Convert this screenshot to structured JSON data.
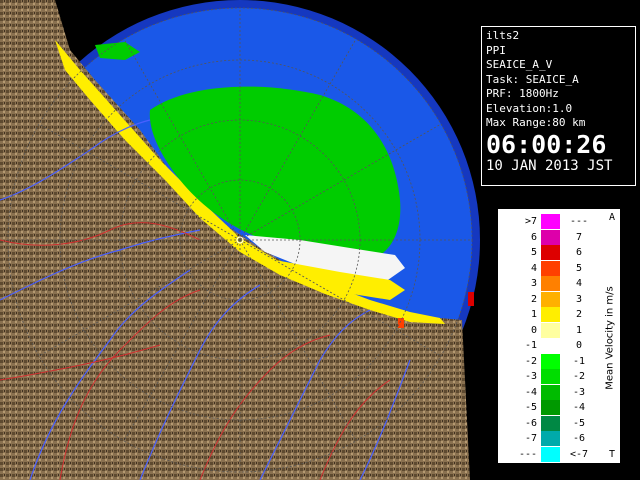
{
  "info": {
    "station": "ilts2",
    "scan_type": "PPI",
    "product": "SEAICE_A_V",
    "task": "Task: SEAICE_A",
    "prf": "PRF: 1800Hz",
    "elevation": "Elevation:1.0",
    "max_range": "Max Range:80 km",
    "time": "06:00:26",
    "date": "10 JAN 2013 JST"
  },
  "legend": {
    "title": "Mean Velocity in m/s",
    "top_mark": "A",
    "bottom_mark": "T",
    "rows": [
      {
        "left": ">7",
        "right": "---",
        "color": "#ff00ff"
      },
      {
        "left": "6",
        "right": "7",
        "color": "#dd00aa"
      },
      {
        "left": "5",
        "right": "6",
        "color": "#dd0000"
      },
      {
        "left": "4",
        "right": "5",
        "color": "#ff4000"
      },
      {
        "left": "3",
        "right": "4",
        "color": "#ff8000"
      },
      {
        "left": "2",
        "right": "3",
        "color": "#ffb000"
      },
      {
        "left": "1",
        "right": "2",
        "color": "#ffee00"
      },
      {
        "left": "0",
        "right": "1",
        "color": "#ffffa0"
      },
      {
        "left": "-1",
        "right": "0",
        "color": "#ffffff"
      },
      {
        "left": "-2",
        "right": "-1",
        "color": "#00ff00"
      },
      {
        "left": "-3",
        "right": "-2",
        "color": "#00dd00"
      },
      {
        "left": "-4",
        "right": "-3",
        "color": "#00bb00"
      },
      {
        "left": "-5",
        "right": "-4",
        "color": "#009900"
      },
      {
        "left": "-6",
        "right": "-5",
        "color": "#008844"
      },
      {
        "left": "-7",
        "right": "-6",
        "color": "#00aaaa"
      },
      {
        "left": "---",
        "right": "<-7",
        "color": "#00ffff"
      }
    ]
  },
  "colors": {
    "sea": "#1a58e8",
    "outer_sea": "#1538c0",
    "land": "#8a7150",
    "echo_green": "#00cc00",
    "echo_yellow": "#ffee00",
    "river": "#4a60ff",
    "road": "#d03030"
  }
}
